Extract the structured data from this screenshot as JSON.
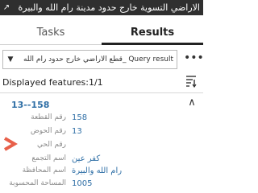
{
  "window": {
    "title": "الاراضي التسوية خارج حدود مدينة رام الله والبيرة",
    "expand_icon": "expand-icon"
  },
  "tabs": [
    {
      "label": "Tasks",
      "active": false
    },
    {
      "label": "Results",
      "active": true
    }
  ],
  "query": {
    "selected": "Query result _قطع الاراضي خارج حدود رام الله",
    "more_label": "•••"
  },
  "results": {
    "displayed_label": "Displayed features:1/1"
  },
  "feature": {
    "title": "13--158",
    "attributes": [
      {
        "label": "رقم القطعة",
        "value": "158"
      },
      {
        "label": "رقم الحوض",
        "value": "13"
      },
      {
        "label": "رقم الحي",
        "value": ""
      },
      {
        "label": "اسم التجمع",
        "value": "كفر عين"
      },
      {
        "label": "اسم المحافظة",
        "value": "رام الله والبيرة"
      },
      {
        "label": "المساحة المحسوبة",
        "value": "1005"
      }
    ]
  },
  "colors": {
    "titlebar": "#2f2f2f",
    "link": "#2f6fa6",
    "flag": "#e8604a"
  }
}
